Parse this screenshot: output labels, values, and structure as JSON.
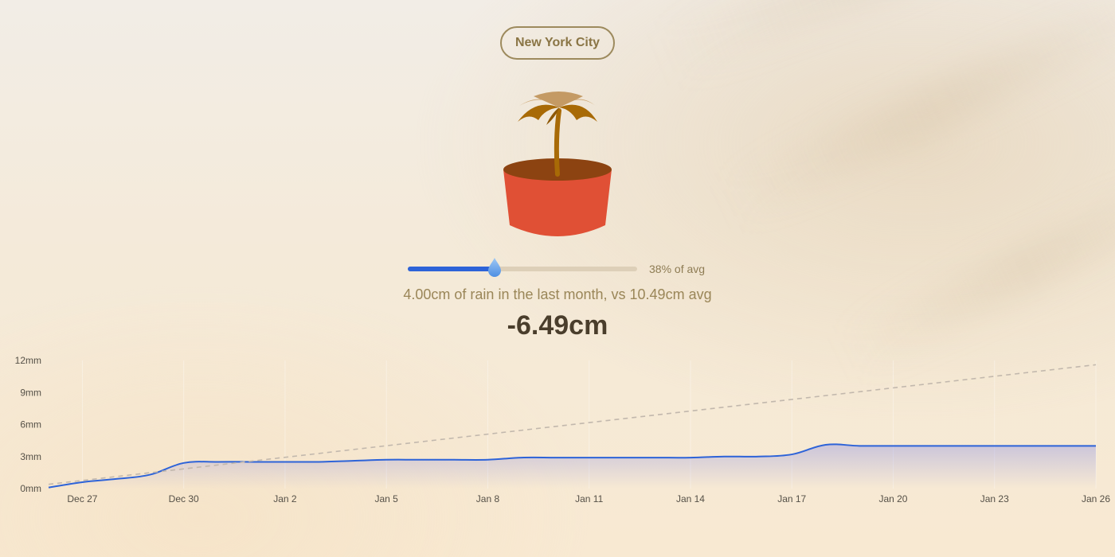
{
  "location": {
    "city": "New York City"
  },
  "rain_meter": {
    "percent_of_avg": 38,
    "percent_label": "38% of avg",
    "summary": "4.00cm of rain in the last month, vs 10.49cm avg",
    "difference": "-6.49cm"
  },
  "colors": {
    "accent": "#2d63d8",
    "pot": "#e05035",
    "soil": "#8c4311",
    "leaf": "#a86a06",
    "text_muted": "#9a8658",
    "text_strong": "#4a3e2c"
  },
  "icons": {
    "plant": "potted-plant-icon",
    "thumb": "water-drop-icon"
  },
  "chart_data": {
    "type": "line",
    "title": "",
    "xlabel": "",
    "ylabel": "",
    "ylim": [
      0,
      12
    ],
    "y_ticks": [
      "12mm",
      "9mm",
      "6mm",
      "3mm",
      "0mm"
    ],
    "y_tick_values": [
      12,
      9,
      6,
      3,
      0
    ],
    "x_ticks": [
      "Dec 27",
      "Dec 30",
      "Jan 2",
      "Jan 5",
      "Jan 8",
      "Jan 11",
      "Jan 14",
      "Jan 17",
      "Jan 20",
      "Jan 23",
      "Jan 26"
    ],
    "x_tick_days": [
      1,
      4,
      7,
      10,
      13,
      16,
      19,
      22,
      25,
      28,
      31
    ],
    "x_range_days": [
      0,
      31
    ],
    "grid": false,
    "series": [
      {
        "style": "solid",
        "color": "#2d63d8",
        "x_days": [
          0,
          1,
          2,
          3,
          4,
          5,
          6,
          7,
          8,
          9,
          10,
          11,
          12,
          13,
          14,
          15,
          16,
          17,
          18,
          19,
          20,
          21,
          22,
          23,
          24,
          25,
          26,
          27,
          28,
          29,
          30,
          31
        ],
        "values": [
          0.1,
          0.6,
          0.9,
          1.3,
          2.4,
          2.5,
          2.5,
          2.5,
          2.5,
          2.6,
          2.7,
          2.7,
          2.7,
          2.7,
          2.9,
          2.9,
          2.9,
          2.9,
          2.9,
          2.9,
          3.0,
          3.0,
          3.2,
          4.1,
          4.0,
          4.0,
          4.0,
          4.0,
          4.0,
          4.0,
          4.0,
          4.0
        ]
      },
      {
        "style": "dashed",
        "color": "#c2b8ad",
        "x_days": [
          0,
          31
        ],
        "values": [
          0.4,
          11.6
        ]
      }
    ]
  }
}
